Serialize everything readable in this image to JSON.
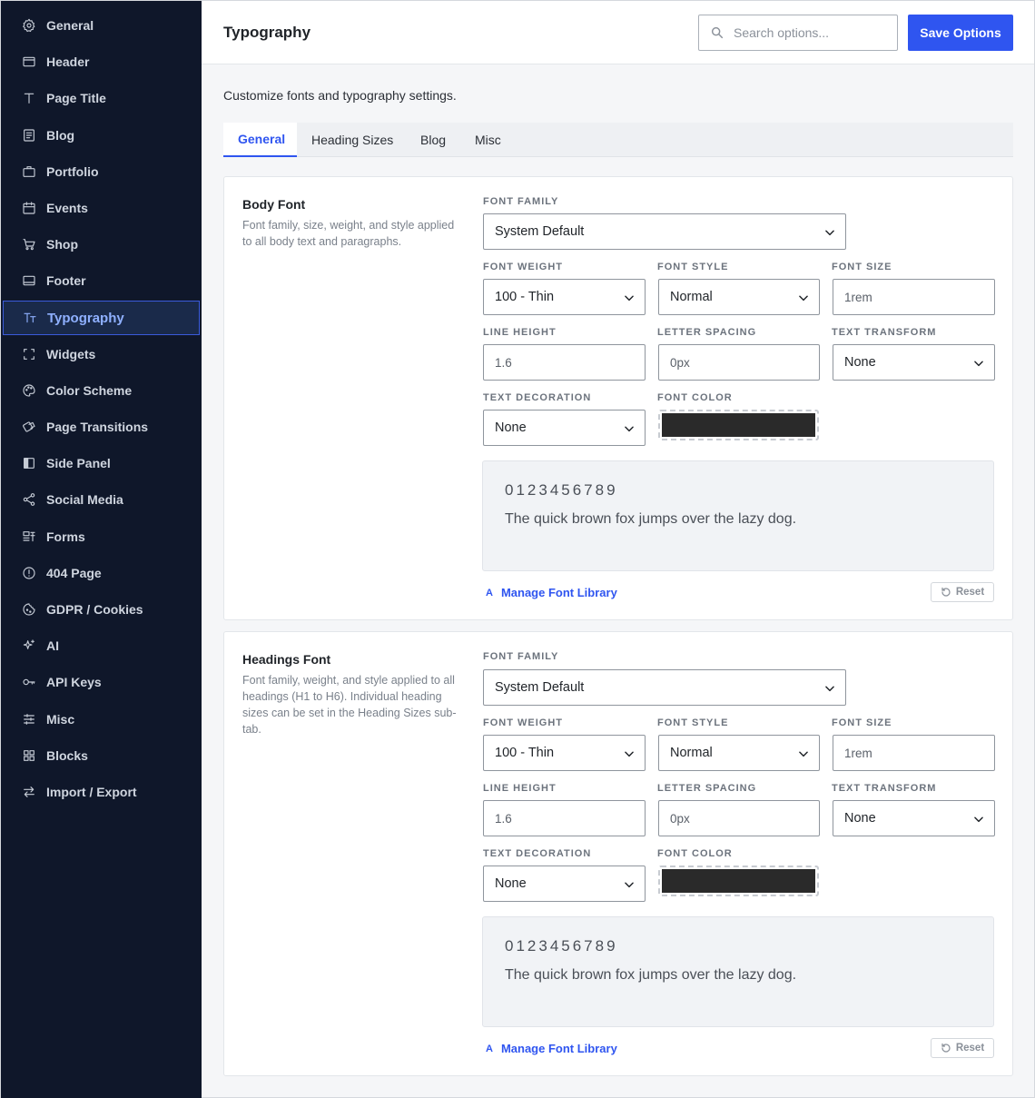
{
  "sidebar": {
    "items": [
      {
        "label": "General",
        "icon": "gear-icon"
      },
      {
        "label": "Header",
        "icon": "header-icon"
      },
      {
        "label": "Page Title",
        "icon": "text-t-icon"
      },
      {
        "label": "Blog",
        "icon": "document-icon"
      },
      {
        "label": "Portfolio",
        "icon": "briefcase-icon"
      },
      {
        "label": "Events",
        "icon": "calendar-icon"
      },
      {
        "label": "Shop",
        "icon": "cart-icon"
      },
      {
        "label": "Footer",
        "icon": "footer-icon"
      },
      {
        "label": "Typography",
        "icon": "typography-icon",
        "active": true
      },
      {
        "label": "Widgets",
        "icon": "widgets-icon"
      },
      {
        "label": "Color Scheme",
        "icon": "palette-icon"
      },
      {
        "label": "Page Transitions",
        "icon": "transitions-icon"
      },
      {
        "label": "Side Panel",
        "icon": "side-panel-icon"
      },
      {
        "label": "Social Media",
        "icon": "share-icon"
      },
      {
        "label": "Forms",
        "icon": "forms-icon"
      },
      {
        "label": "404 Page",
        "icon": "alert-circle-icon"
      },
      {
        "label": "GDPR / Cookies",
        "icon": "cookie-icon"
      },
      {
        "label": "AI",
        "icon": "sparkle-icon"
      },
      {
        "label": "API Keys",
        "icon": "key-icon"
      },
      {
        "label": "Misc",
        "icon": "sliders-icon"
      },
      {
        "label": "Blocks",
        "icon": "blocks-icon"
      },
      {
        "label": "Import / Export",
        "icon": "arrows-swap-icon"
      }
    ]
  },
  "header": {
    "title": "Typography",
    "search_placeholder": "Search options...",
    "save_label": "Save Options"
  },
  "main": {
    "description": "Customize fonts and typography settings.",
    "tabs": [
      {
        "label": "General",
        "active": true
      },
      {
        "label": "Heading Sizes"
      },
      {
        "label": "Blog"
      },
      {
        "label": "Misc"
      }
    ]
  },
  "labels": {
    "font_family": "FONT FAMILY",
    "font_weight": "FONT WEIGHT",
    "font_style": "FONT STYLE",
    "font_size": "FONT SIZE",
    "line_height": "LINE HEIGHT",
    "letter_spacing": "LETTER SPACING",
    "text_transform": "TEXT TRANSFORM",
    "text_decoration": "TEXT DECORATION",
    "font_color": "FONT COLOR",
    "manage": "Manage Font Library",
    "reset": "Reset"
  },
  "body_font": {
    "title": "Body Font",
    "description": "Font family, size, weight, and style applied to all body text and paragraphs.",
    "font_family": "System Default",
    "font_weight": "100 - Thin",
    "font_style": "Normal",
    "font_size": "1rem",
    "line_height": "1.6",
    "letter_spacing": "0px",
    "text_transform": "None",
    "text_decoration": "None",
    "font_color": "#2a2a2a",
    "preview_digits": "0123456789",
    "preview_text": "The quick brown fox jumps over the lazy dog."
  },
  "headings_font": {
    "title": "Headings Font",
    "description": "Font family, weight, and style applied to all headings (H1 to H6). Individual heading sizes can be set in the Heading Sizes sub-tab.",
    "font_family": "System Default",
    "font_weight": "100 - Thin",
    "font_style": "Normal",
    "font_size": "1rem",
    "line_height": "1.6",
    "letter_spacing": "0px",
    "text_transform": "None",
    "text_decoration": "None",
    "font_color": "#2a2a2a",
    "preview_digits": "0123456789",
    "preview_text": "The quick brown fox jumps over the lazy dog."
  },
  "colors": {
    "sidebar_bg": "#0f172a",
    "accent": "#2f55f0"
  }
}
